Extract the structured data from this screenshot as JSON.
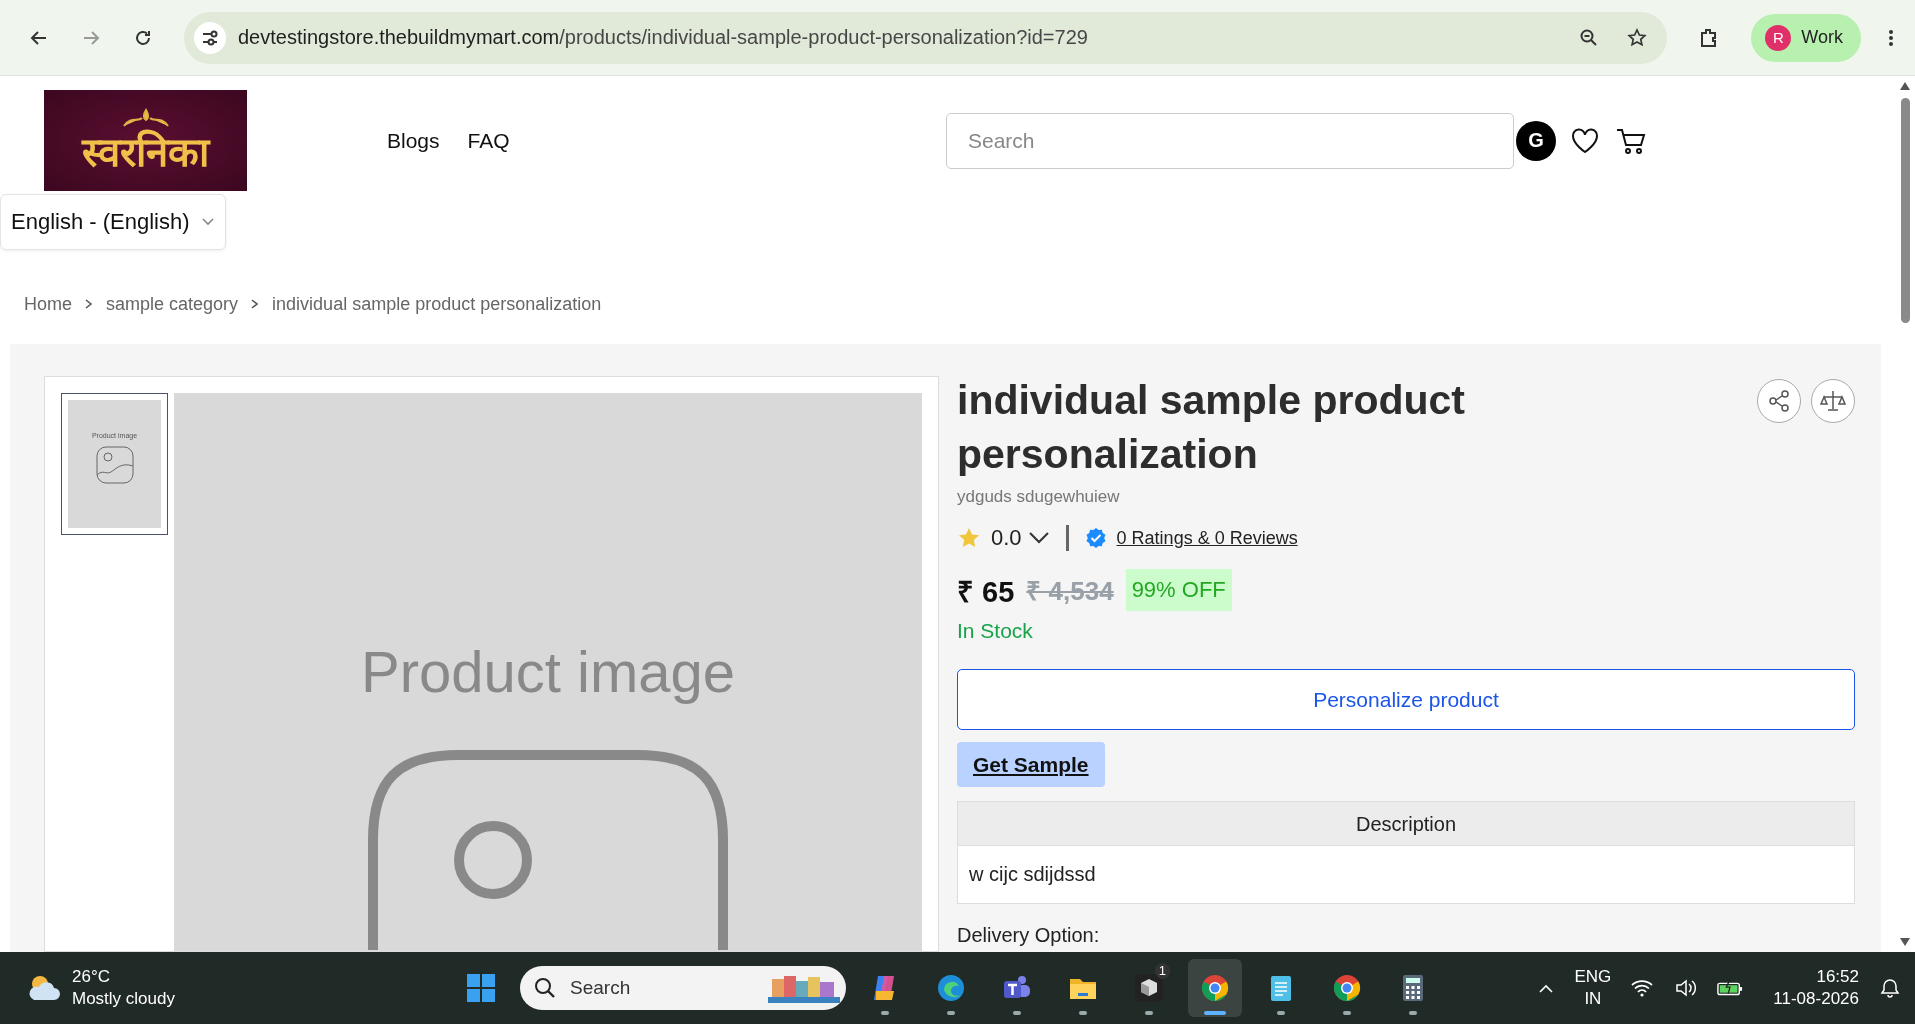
{
  "browser": {
    "url_host": "devtestingstore.thebuildmymart.com",
    "url_path": "/products/individual-sample-product-personalization?id=729",
    "profile_initial": "R",
    "profile_label": "Work"
  },
  "header": {
    "logo_text": "स्वरनिका",
    "nav": [
      "Blogs",
      "FAQ"
    ],
    "search": {
      "placeholder": "Search"
    },
    "avatar": "G",
    "language": "English - (English)"
  },
  "breadcrumb": [
    "Home",
    "sample category",
    "individual sample product personalization"
  ],
  "gallery": {
    "thumbnails": [
      {
        "label": "Product image",
        "selected": true
      }
    ],
    "main_label": "Product image"
  },
  "product": {
    "title": "individual sample product personalization",
    "subtitle": "ydguds sdugewhuiew",
    "rating": "0.0",
    "reviews_link": "0 Ratings & 0 Reviews",
    "price": "₹ 65",
    "mrp": "₹ 4,534",
    "discount": "99% OFF",
    "stock": "In Stock",
    "personalize_button": "Personalize product",
    "sample_button": "Get Sample",
    "description": {
      "heading": "Description",
      "body": "w cijc sdijdssd"
    },
    "delivery_label": "Delivery Option:"
  },
  "taskbar": {
    "weather": {
      "temp": "26°C",
      "desc": "Mostly cloudy"
    },
    "search": {
      "placeholder": "Search"
    },
    "apps": [
      {
        "kind": "start",
        "selected": false
      },
      {
        "kind": "copilot",
        "selected": false
      },
      {
        "kind": "edge",
        "selected": false
      },
      {
        "kind": "teams",
        "selected": false
      },
      {
        "kind": "folder",
        "selected": false
      },
      {
        "kind": "cube",
        "selected": false,
        "badge": "1"
      },
      {
        "kind": "chrome",
        "selected": true
      },
      {
        "kind": "notepad",
        "selected": false
      },
      {
        "kind": "chrome",
        "selected": false
      },
      {
        "kind": "calculator",
        "selected": false
      }
    ],
    "lang": "ENG",
    "region": "IN",
    "time": "16:52",
    "date": "11-08-2026"
  }
}
